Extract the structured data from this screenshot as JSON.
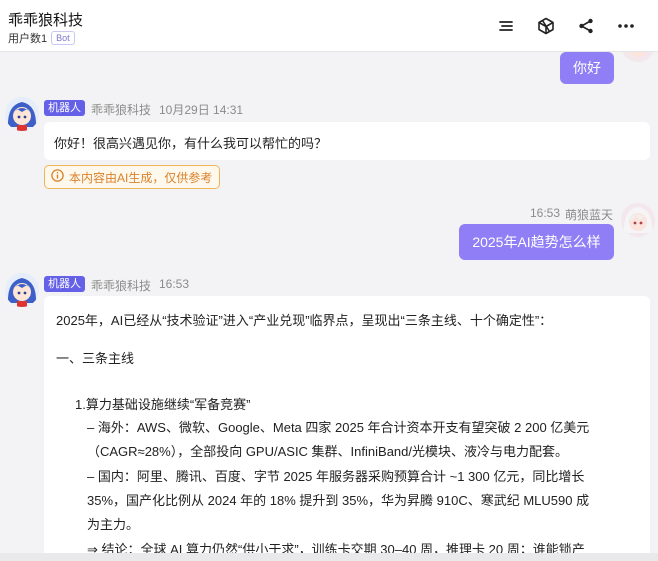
{
  "header": {
    "title": "乖乖狼科技",
    "subtitle": "用户数1",
    "badge": "Bot",
    "icons": [
      "list-icon",
      "cube-icon",
      "share-icon",
      "more-icon"
    ]
  },
  "messages": {
    "user1": {
      "text": "你好"
    },
    "bot1": {
      "tag": "机器人",
      "name": "乖乖狼科技",
      "time": "10月29日 14:31",
      "text": "你好！很高兴遇见你，有什么我可以帮忙的吗？",
      "notice": "本内容由AI生成，仅供参考"
    },
    "user2": {
      "time": "16:53",
      "name": "萌狼蓝天",
      "text": "2025年AI趋势怎么样"
    },
    "bot2": {
      "tag": "机器人",
      "name": "乖乖狼科技",
      "time": "16:53",
      "lines": [
        "2025年，AI已经从“技术验证”进入“产业兑现”临界点，呈现出“三条主线、十个确定性”：",
        "一、三条主线",
        "1.算力基础设施继续“军备竞赛”",
        "– 海外：AWS、微软、Google、Meta 四家 2025 年合计资本开支有望突破 2 200 亿美元",
        "（CAGR≈28%），全部投向 GPU/ASIC 集群、InfiniBand/光模块、液冷与电力配套。",
        "– 国内：阿里、腾讯、百度、字节 2025 年服务器采购预算合计 ~1 300 亿元，同比增长",
        "35%，国产化比例从 2024 年的 18% 提升到 35%，华为昇腾 910C、寒武纪 MLU590 成",
        "为主力。",
        "⇒ 结论：全球 AI 算力仍然“供小于求”，训练卡交期 30–40 周，推理卡 20 周；谁能锁产"
      ]
    }
  },
  "colors": {
    "user_bubble": "#8f7ef5",
    "bot_tag": "#6560e8",
    "notice": "#d9822b",
    "background": "#f3f3f5"
  }
}
